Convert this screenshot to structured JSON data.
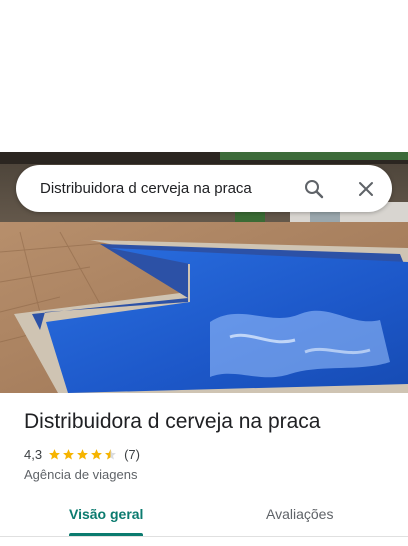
{
  "search": {
    "query": "Distribuidora d cerveja na praca",
    "search_icon": "search-icon",
    "clear_icon": "close-icon"
  },
  "place": {
    "title": "Distribuidora d cerveja na praca",
    "rating": "4,3",
    "rating_value": 4.3,
    "rating_max": 5,
    "reviews": "(7)",
    "category": "Agência de viagens"
  },
  "tabs": [
    {
      "label": "Visão geral",
      "active": true
    },
    {
      "label": "Avaliações",
      "active": false
    }
  ],
  "colors": {
    "accent": "#0b7b6f",
    "star": "#f6b400",
    "pool": "#1f5fd1"
  }
}
